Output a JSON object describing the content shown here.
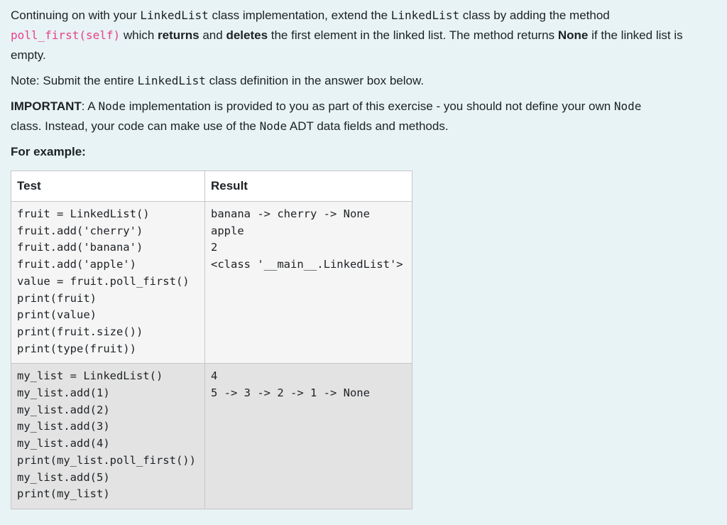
{
  "question": {
    "p1": {
      "t1": "Continuing on with your ",
      "c1": "LinkedList",
      "t2": " class implementation, extend the ",
      "c2": "LinkedList",
      "t3": " class by adding the method ",
      "c3": "poll_first(self)",
      "t4": " which ",
      "b1": "returns",
      "t5": " and ",
      "b2": "deletes",
      "t6": " the first element in the linked list. The method returns ",
      "b3": "None",
      "t7": " if the linked list is empty."
    },
    "p2": {
      "t1": "Note: Submit the entire ",
      "c1": "LinkedList",
      "t2": " class definition in the answer box below."
    },
    "p3": {
      "b1": "IMPORTANT",
      "t1": ": A ",
      "c1": "Node",
      "t2": " implementation is provided to you as part of this exercise - you should not define your own ",
      "c2": "Node",
      "t3": " class. Instead, your code can make use of the ",
      "c3": "Node",
      "t4": " ADT data fields and methods."
    },
    "p4": "For example:"
  },
  "table": {
    "headers": [
      "Test",
      "Result"
    ],
    "rows": [
      {
        "test": "fruit = LinkedList()\nfruit.add('cherry')\nfruit.add('banana')\nfruit.add('apple')\nvalue = fruit.poll_first()\nprint(fruit)\nprint(value)\nprint(fruit.size())\nprint(type(fruit))",
        "result": "banana -> cherry -> None\napple\n2\n<class '__main__.LinkedList'>"
      },
      {
        "test": "my_list = LinkedList()\nmy_list.add(1)\nmy_list.add(2)\nmy_list.add(3)\nmy_list.add(4)\nprint(my_list.poll_first())\nmy_list.add(5)\nprint(my_list)",
        "result": "4\n5 -> 3 -> 2 -> 1 -> None"
      }
    ]
  },
  "colors": {
    "background": "#e7f3f5",
    "code_pink": "#e83e8c",
    "row_light": "#f5f5f5",
    "row_dark": "#e3e3e3"
  }
}
